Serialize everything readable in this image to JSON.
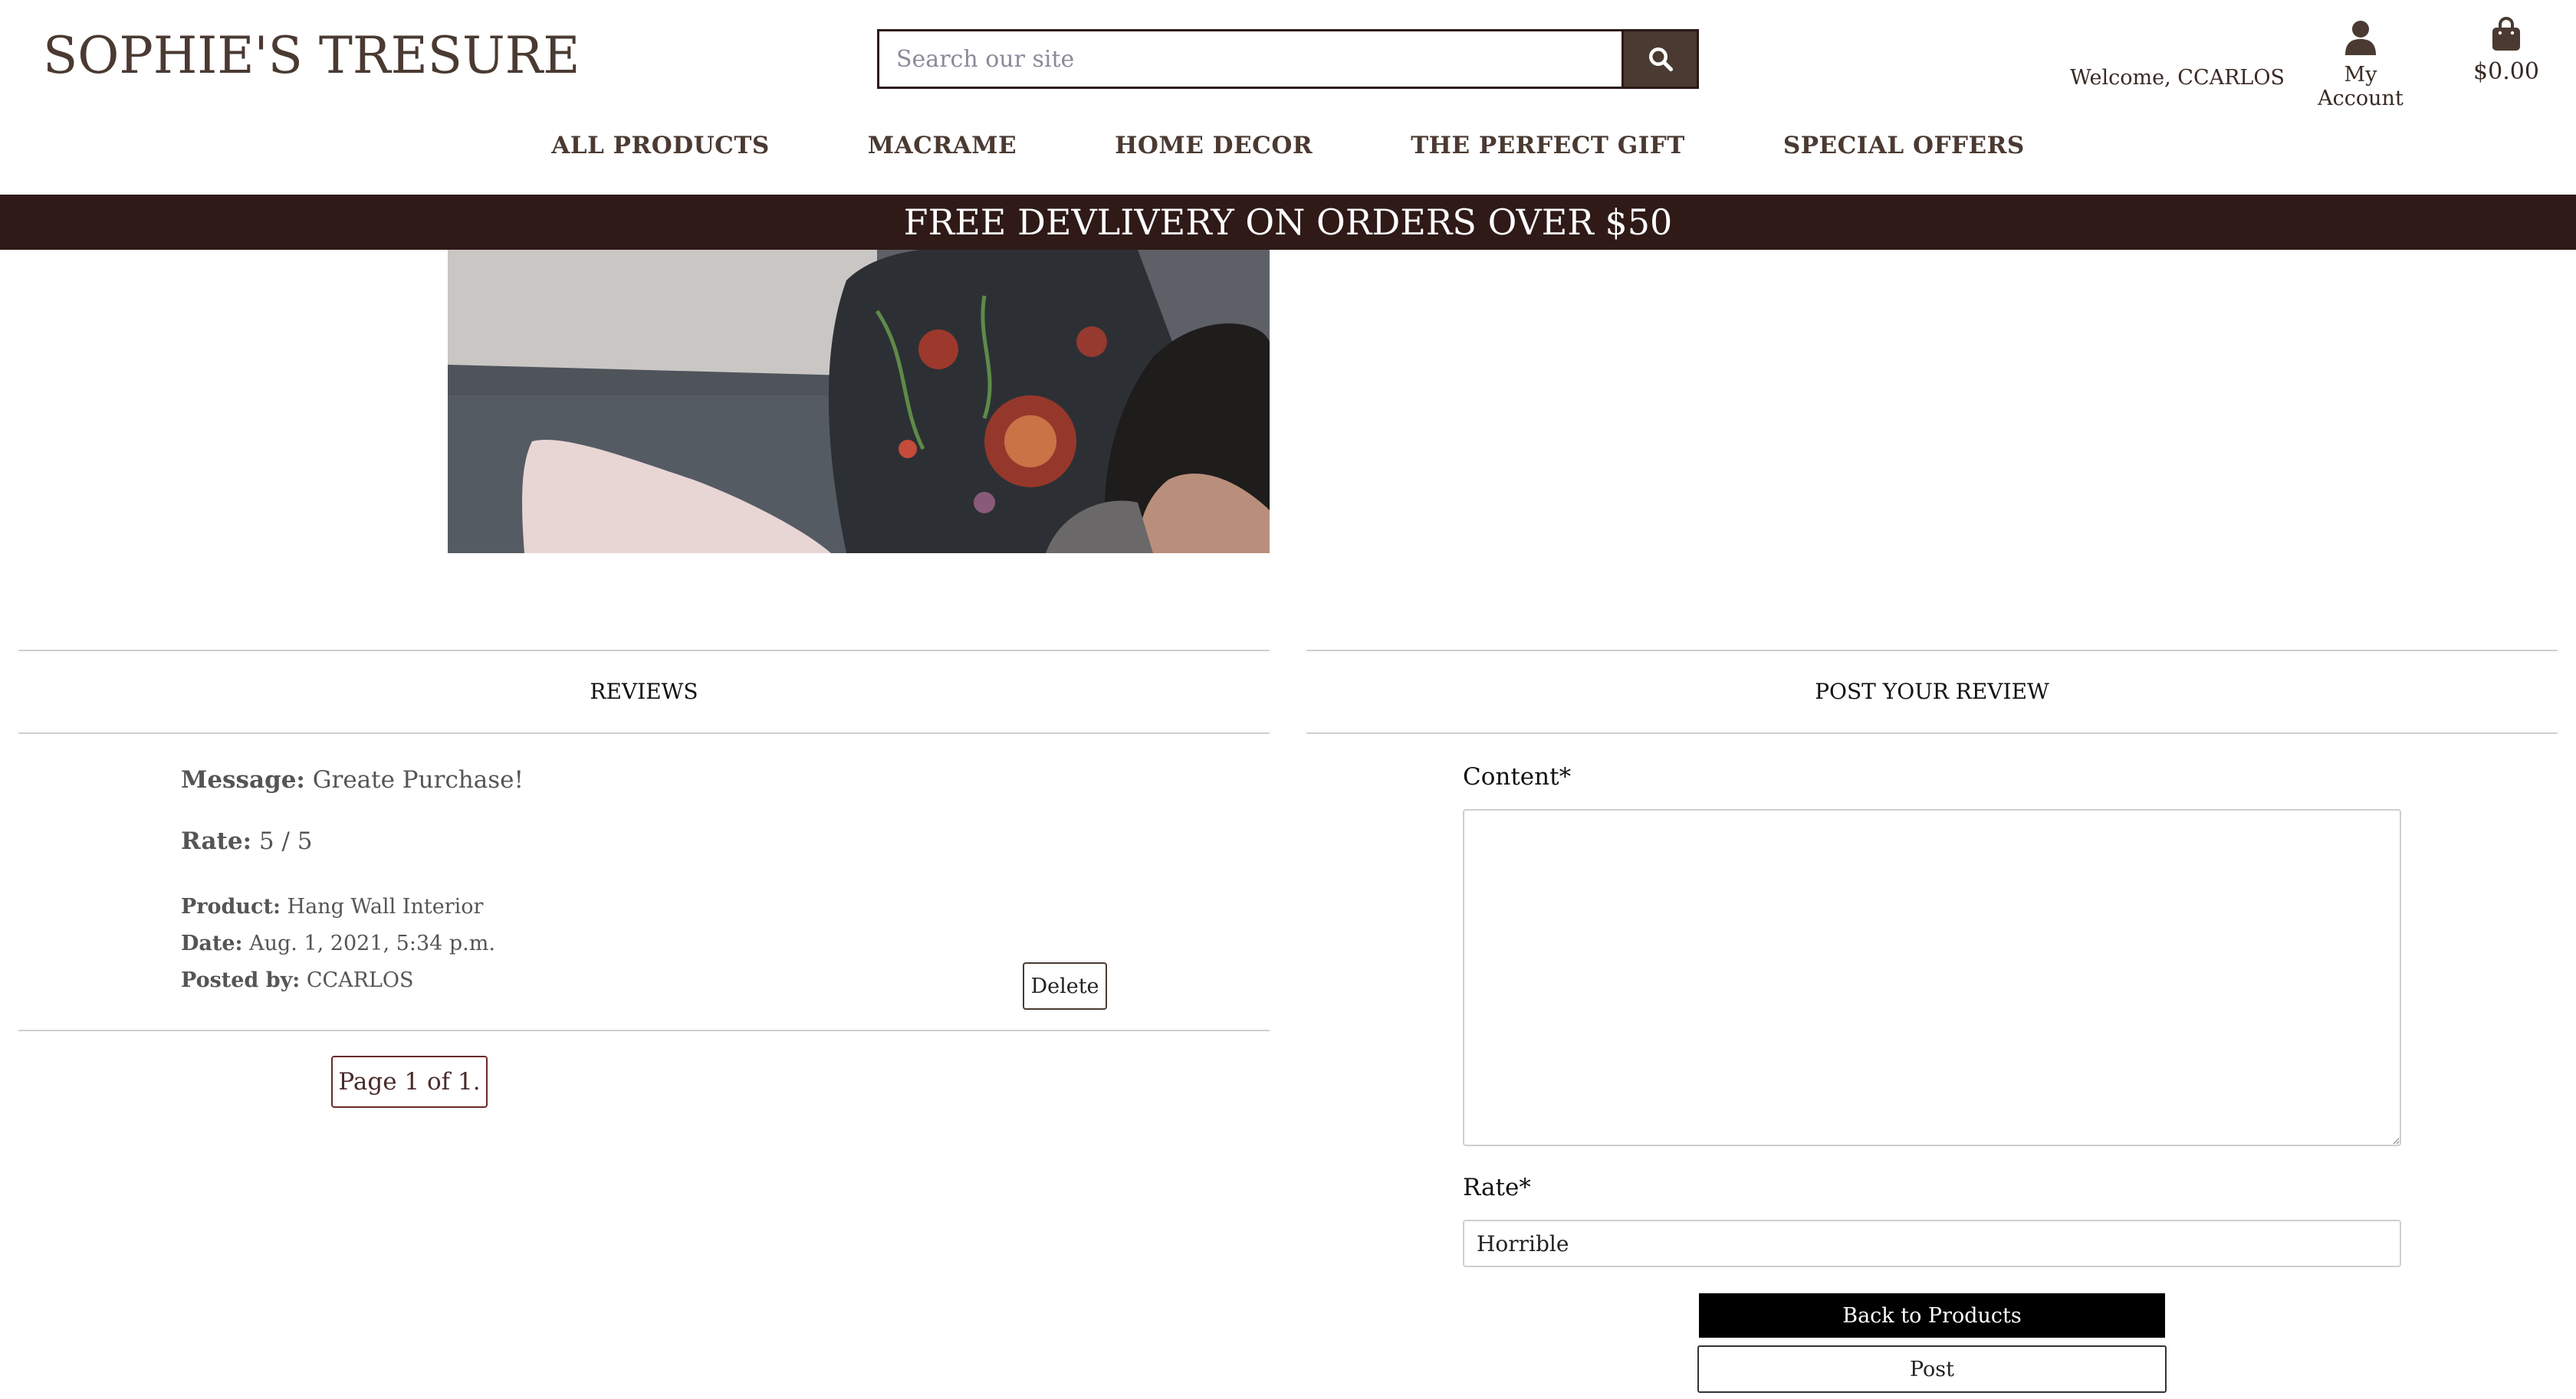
{
  "header": {
    "logo": "SOPHIE'S TRESURE",
    "search_placeholder": "Search our site",
    "welcome": "Welcome, CCARLOS",
    "account_label": "My Account",
    "cart_total": "$0.00"
  },
  "nav": {
    "items": [
      "ALL PRODUCTS",
      "MACRAME",
      "HOME DECOR",
      "THE PERFECT GIFT",
      "SPECIAL OFFERS"
    ]
  },
  "banner": {
    "text": "FREE DEVLIVERY ON ORDERS OVER $50"
  },
  "reviews": {
    "title": "REVIEWS",
    "items": [
      {
        "message_label": "Message:",
        "message": "Greate Purchase!",
        "rate_label": "Rate:",
        "rate": "5 / 5",
        "product_label": "Product:",
        "product": "Hang Wall Interior",
        "date_label": "Date:",
        "date": "Aug. 1, 2021, 5:34 p.m.",
        "posted_label": "Posted by:",
        "posted_by": "CCARLOS",
        "delete_label": "Delete"
      }
    ],
    "pagination": "Page 1 of 1."
  },
  "post_review": {
    "title": "POST YOUR REVIEW",
    "content_label": "Content*",
    "rate_label": "Rate*",
    "rate_value": "Horrible",
    "back_label": "Back to Products",
    "post_label": "Post"
  },
  "colors": {
    "brand_brown": "#4a3a32",
    "banner_bg": "#2f1a18",
    "black_button": "#000000"
  }
}
